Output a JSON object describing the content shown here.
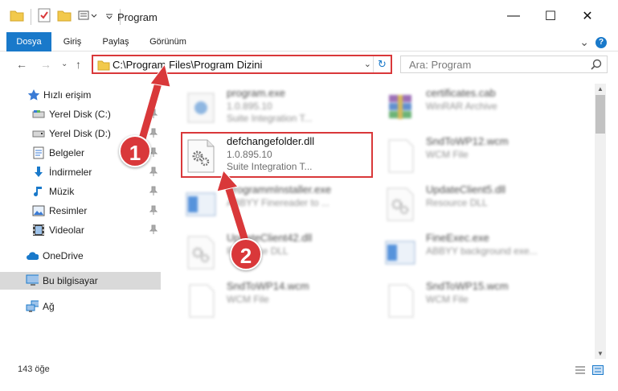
{
  "window": {
    "title": "Program",
    "minimize_label": "—",
    "maximize_label": "☐",
    "close_label": "✕"
  },
  "ribbon": {
    "tabs": [
      "Dosya",
      "Giriş",
      "Paylaş",
      "Görünüm"
    ],
    "expand_glyph": "⌄",
    "help_glyph": "?"
  },
  "nav": {
    "back_glyph": "←",
    "forward_glyph": "→",
    "recent_glyph": "⌄",
    "up_glyph": "↑",
    "address": "C:\\Program Files\\Program Dizini",
    "dropdown_glyph": "⌄",
    "refresh_glyph": "↻",
    "search_placeholder": "Ara: Program"
  },
  "sidebar": {
    "quick_access": "Hızlı erişim",
    "items": [
      {
        "label": "Yerel Disk (C:)",
        "icon": "drive-icon",
        "pinned": true
      },
      {
        "label": "Yerel Disk (D:)",
        "icon": "drive-icon",
        "pinned": true
      },
      {
        "label": "Belgeler",
        "icon": "documents-icon",
        "pinned": true
      },
      {
        "label": "İndirmeler",
        "icon": "downloads-icon",
        "pinned": true
      },
      {
        "label": "Müzik",
        "icon": "music-icon",
        "pinned": true
      },
      {
        "label": "Resimler",
        "icon": "pictures-icon",
        "pinned": true
      },
      {
        "label": "Videolar",
        "icon": "videos-icon",
        "pinned": true
      }
    ],
    "onedrive": "OneDrive",
    "this_pc": "Bu bilgisayar",
    "network": "Ağ",
    "pin_glyph": "📌"
  },
  "files": [
    {
      "name": "program.exe",
      "line2": "1.0.895.10",
      "line3": "Suite Integration T...",
      "icon": "exe-icon"
    },
    {
      "name": "certificates.cab",
      "line2": "WinRAR Archive",
      "line3": "",
      "icon": "archive-icon"
    },
    {
      "name": "defchangefolder.dll",
      "line2": "1.0.895.10",
      "line3": "Suite Integration T...",
      "icon": "dll-gear-icon"
    },
    {
      "name": "SndToWP12.wcm",
      "line2": "WCM File",
      "line3": "",
      "icon": "blank-file-icon"
    },
    {
      "name": "ProgrammInstaller.exe",
      "line2": "ABBYY Finereader to ...",
      "line3": "",
      "icon": "app-window-icon"
    },
    {
      "name": "UpdateClient5.dll",
      "line2": "Resource DLL",
      "line3": "",
      "icon": "dll-gear-icon"
    },
    {
      "name": "UpdateClient42.dll",
      "line2": "Resource DLL",
      "line3": "",
      "icon": "dll-gear-icon"
    },
    {
      "name": "FineExec.exe",
      "line2": "ABBYY background exe...",
      "line3": "",
      "icon": "app-window-icon"
    },
    {
      "name": "SndToWP14.wcm",
      "line2": "WCM File",
      "line3": "",
      "icon": "blank-file-icon"
    },
    {
      "name": "SndToWP15.wcm",
      "line2": "WCM File",
      "line3": "",
      "icon": "blank-file-icon"
    }
  ],
  "status": {
    "item_count": "143 öğe"
  },
  "annotations": {
    "marker1": "1",
    "marker2": "2",
    "color": "#d9383a"
  },
  "colors": {
    "accent": "#1979ca",
    "highlight": "#d9383a",
    "folder": "#f2c94c"
  }
}
